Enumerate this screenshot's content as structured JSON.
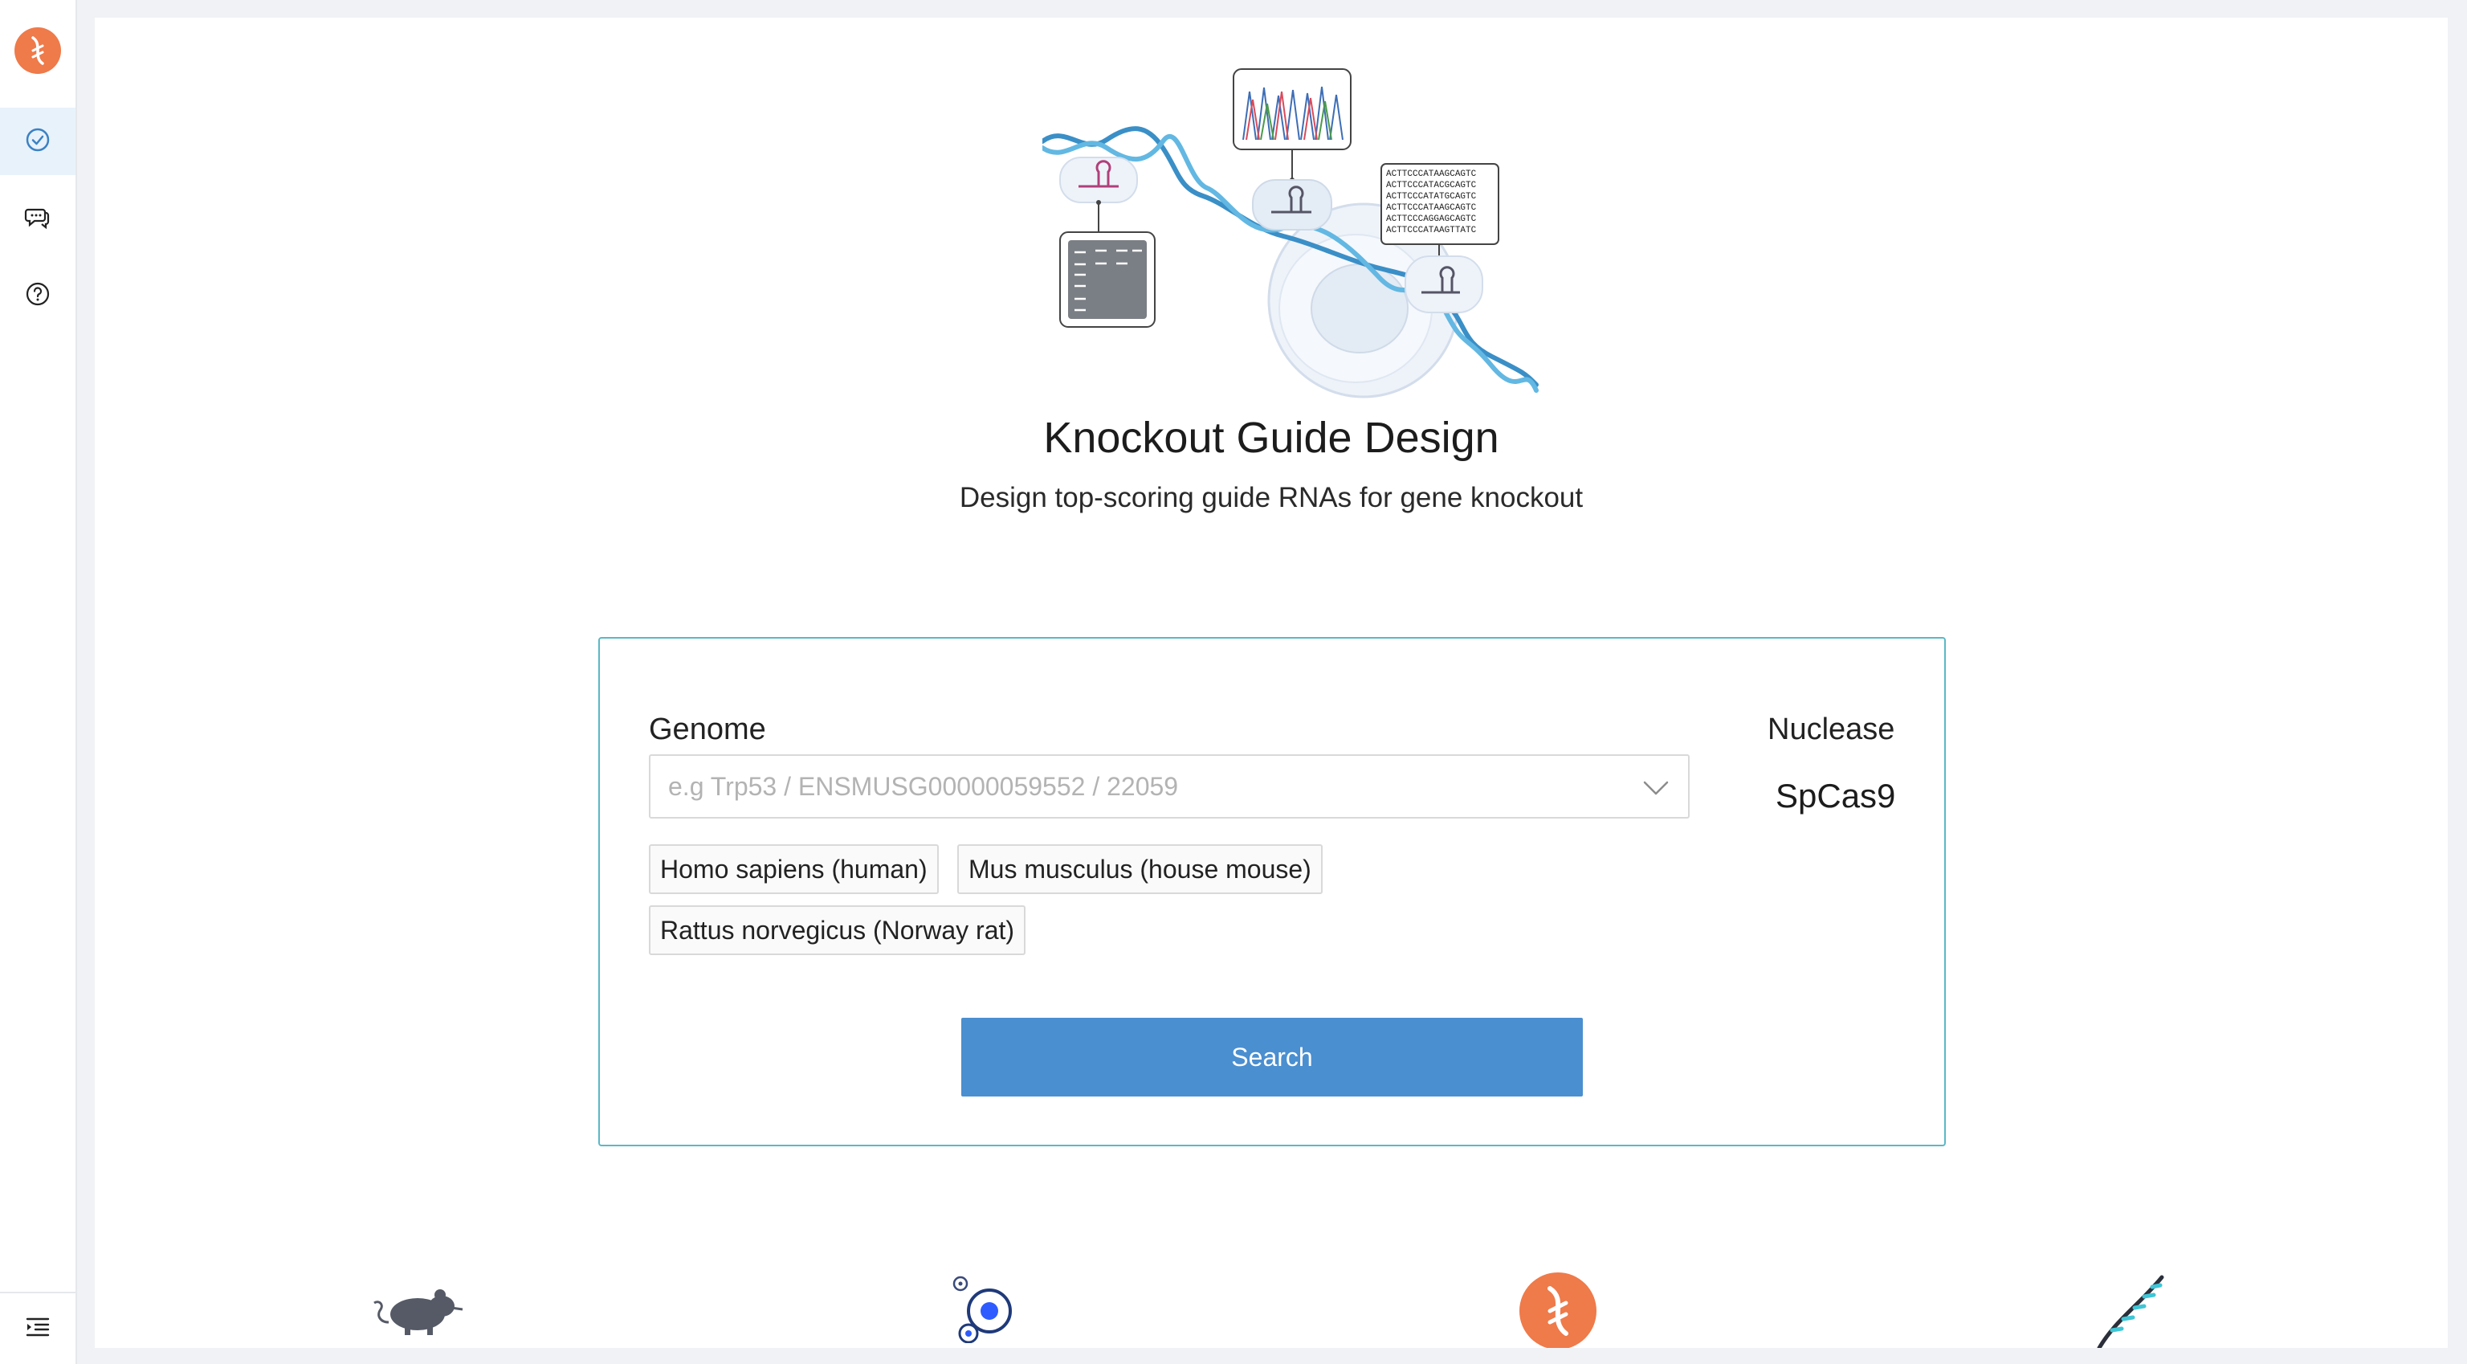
{
  "sidebar": {
    "logo_icon": "dna-logo-icon",
    "items": [
      {
        "icon": "check-circle-icon",
        "active": true
      },
      {
        "icon": "chat-bubbles-icon",
        "active": false
      },
      {
        "icon": "help-circle-icon",
        "active": false
      }
    ],
    "collapse_icon": "menu-indent-icon"
  },
  "main": {
    "title": "Knockout Guide Design",
    "subtitle": "Design top-scoring guide RNAs for gene knockout"
  },
  "form": {
    "genome_label": "Genome",
    "genome_placeholder": "e.g Trp53 / ENSMUSG00000059552 / 22059",
    "genome_options": [
      "Homo sapiens (human)",
      "Mus musculus (house mouse)",
      "Rattus norvegicus (Norway rat)"
    ],
    "nuclease_label": "Nuclease",
    "nuclease_value": "SpCas9",
    "search_label": "Search"
  },
  "hero": {
    "sequences": [
      "ACTTCCCATAAGCAGTC",
      "ACTTCCCATACGCAGTC",
      "ACTTCCCATATGCAGTC",
      "ACTTCCCATAAGCAGTC",
      "ACTTCCCAGGAGCAGTC",
      "ACTTCCCATAAGTTATC"
    ]
  },
  "bottom_icons": [
    "mouse-icon",
    "cell-icon",
    "dna-logo-icon",
    "dna-strand-icon"
  ],
  "colors": {
    "brand_orange": "#ef7a4a",
    "primary_blue": "#4a8fd0",
    "card_border": "#5bb8c4",
    "dna_blue": "#4aa8d8",
    "sidebar_active_bg": "#e8f2fb"
  }
}
